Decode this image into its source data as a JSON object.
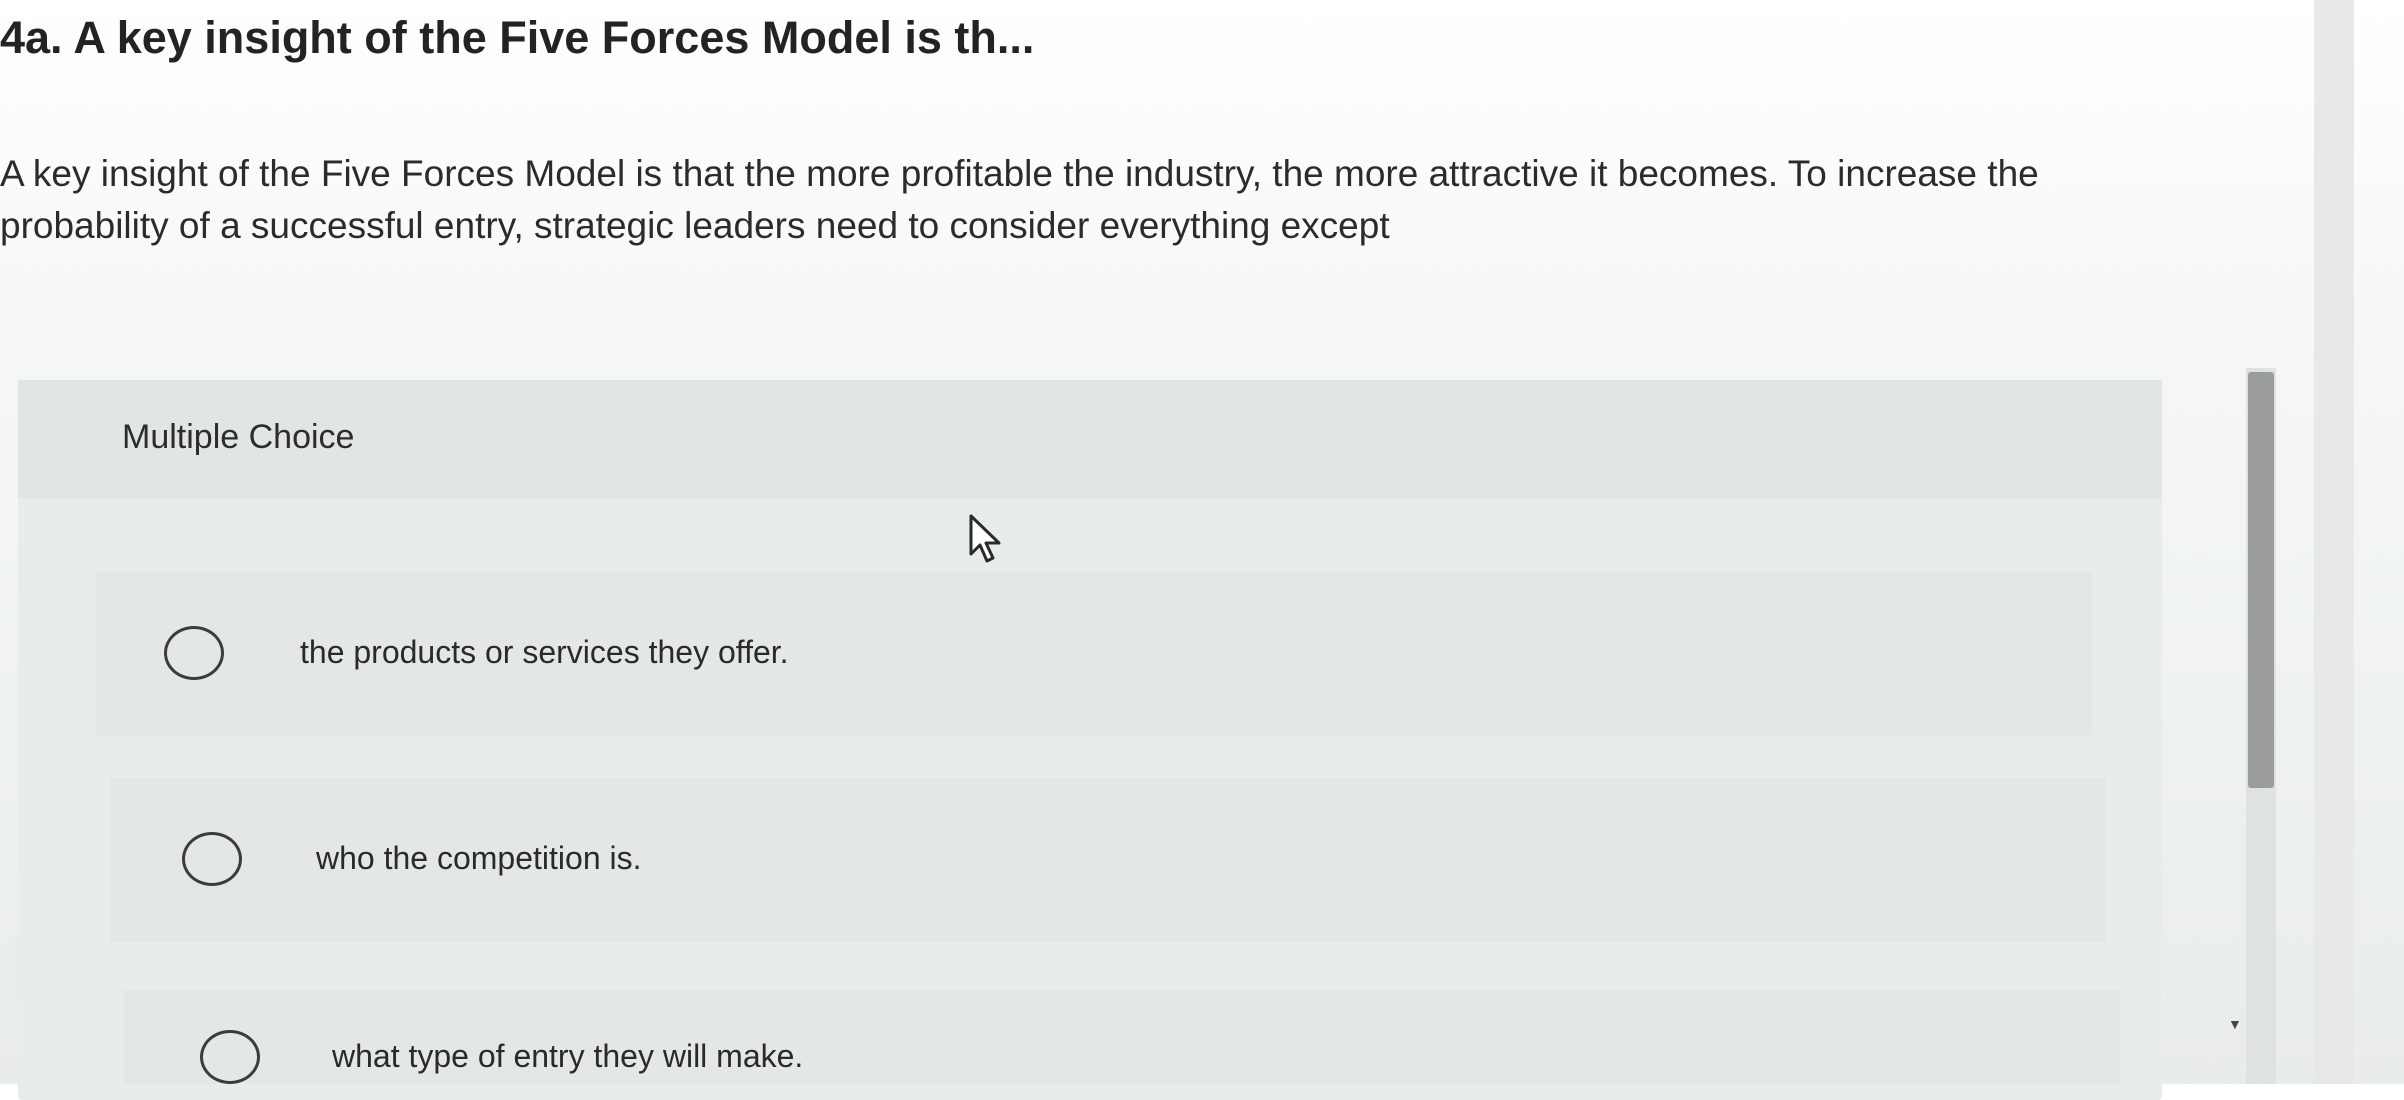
{
  "question": {
    "title": "4a. A key insight of the Five Forces Model is th...",
    "text": "A key insight of the Five Forces Model is that the more profitable the industry, the more attractive it becomes. To increase the probability of a successful entry, strategic leaders need to consider everything except"
  },
  "choices": {
    "header": "Multiple Choice",
    "options": [
      {
        "label": "the products or services they offer."
      },
      {
        "label": "who the competition is."
      },
      {
        "label": "what type of entry they will make."
      }
    ]
  },
  "icons": {
    "cursor": "mouse-pointer-icon",
    "radio": "radio-button-icon",
    "scroll_down": "scroll-down-arrow-icon"
  },
  "colors": {
    "background": "#eef1f2",
    "card": "#e9eced",
    "text": "#2b2b2b",
    "scrollbar_thumb": "#9a9c9d"
  }
}
